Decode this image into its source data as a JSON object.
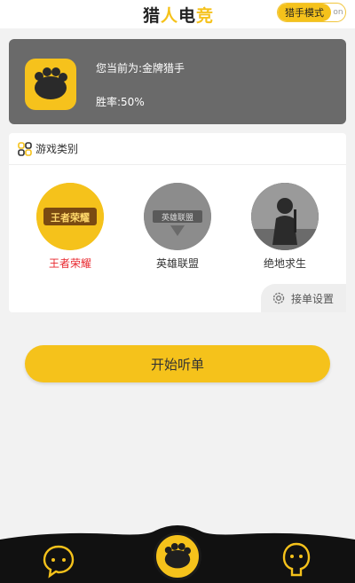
{
  "header": {
    "brand": {
      "part1": "猎",
      "part2": "人",
      "part3": "电",
      "part4": "竞"
    },
    "mode_label": "猎手模式",
    "mode_rest": "on"
  },
  "user": {
    "rank_text": "您当前为:金牌猎手",
    "rate_text": "胜率:50%"
  },
  "games": {
    "title": "游戏类别",
    "items": [
      {
        "name": "王者荣耀",
        "icon": "honor-of-kings-logo",
        "logo_text": "王者荣耀"
      },
      {
        "name": "英雄联盟",
        "icon": "league-of-legends-logo",
        "logo_text": "英雄联盟"
      },
      {
        "name": "绝地求生",
        "icon": "pubg-logo"
      }
    ],
    "settings_label": "接单设置"
  },
  "start_button": "开始听单",
  "colors": {
    "accent": "#f5c21b",
    "card": "#6a6a6a",
    "active": "#e8262c"
  }
}
